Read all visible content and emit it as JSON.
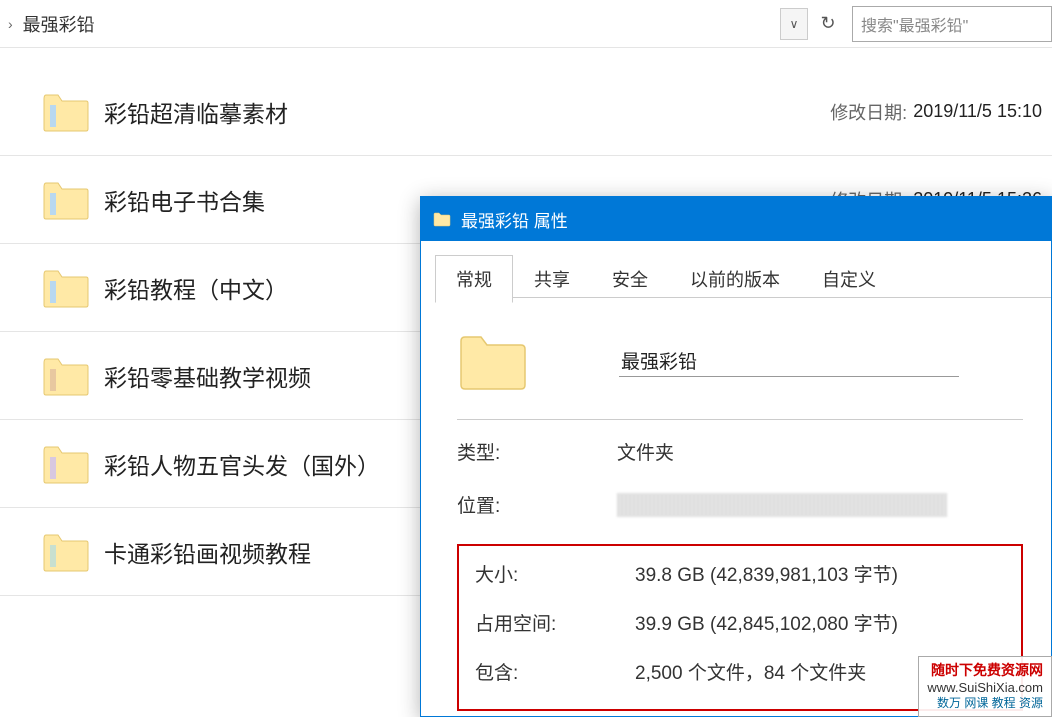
{
  "breadcrumb": {
    "current": "最强彩铅"
  },
  "search": {
    "placeholder": "搜索\"最强彩铅\""
  },
  "date_label": "修改日期:",
  "files": [
    {
      "name": "彩铅超清临摹素材",
      "date": "2019/11/5 15:10"
    },
    {
      "name": "彩铅电子书合集",
      "date": "2019/11/5 15:26"
    },
    {
      "name": "彩铅教程（中文）",
      "date": ""
    },
    {
      "name": "彩铅零基础教学视频",
      "date": ""
    },
    {
      "name": "彩铅人物五官头发（国外）",
      "date": ""
    },
    {
      "name": "卡通彩铅画视频教程",
      "date": ""
    }
  ],
  "dialog": {
    "title": "最强彩铅 属性",
    "tabs": [
      "常规",
      "共享",
      "安全",
      "以前的版本",
      "自定义"
    ],
    "folder_name": "最强彩铅",
    "type_label": "类型:",
    "type_value": "文件夹",
    "location_label": "位置:",
    "size_label": "大小:",
    "size_value": "39.8 GB (42,839,981,103 字节)",
    "disk_label": "占用空间:",
    "disk_value": "39.9 GB (42,845,102,080 字节)",
    "contains_label": "包含:",
    "contains_value": "2,500 个文件，84 个文件夹"
  },
  "watermark": {
    "line1": "随时下免费资源网",
    "line2": "www.SuiShiXia.com",
    "line3": "数万 网课 教程 资源"
  }
}
